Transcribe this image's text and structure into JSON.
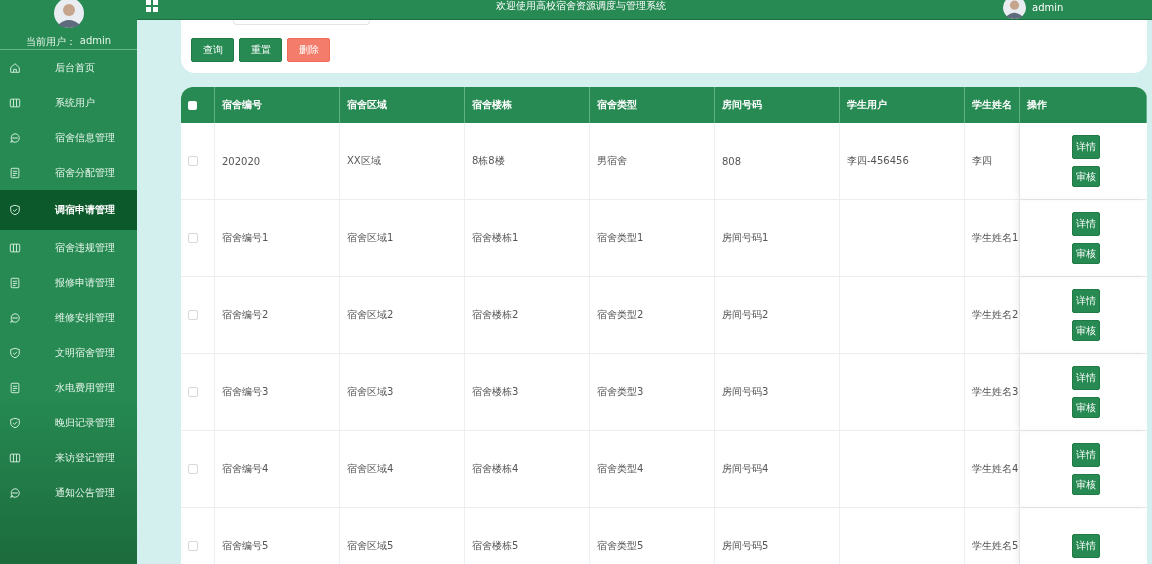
{
  "sidebar": {
    "current_user_label": "当前用户：",
    "current_user": "admin",
    "items": [
      {
        "label": "后台首页",
        "selected": false
      },
      {
        "label": "系统用户",
        "selected": false
      },
      {
        "label": "宿舍信息管理",
        "selected": false
      },
      {
        "label": "宿舍分配管理",
        "selected": false
      },
      {
        "label": "调宿申请管理",
        "selected": true
      },
      {
        "label": "宿舍违规管理",
        "selected": false
      },
      {
        "label": "报修申请管理",
        "selected": false
      },
      {
        "label": "维修安排管理",
        "selected": false
      },
      {
        "label": "文明宿舍管理",
        "selected": false
      },
      {
        "label": "水电费用管理",
        "selected": false
      },
      {
        "label": "晚归记录管理",
        "selected": false
      },
      {
        "label": "来访登记管理",
        "selected": false
      },
      {
        "label": "通知公告管理",
        "selected": false
      }
    ]
  },
  "header": {
    "title": "欢迎使用高校宿舍资源调度与管理系统",
    "user": "admin"
  },
  "toolbar": {
    "buttons": [
      {
        "label": "查询",
        "kind": "primary"
      },
      {
        "label": "重置",
        "kind": "primary"
      },
      {
        "label": "删除",
        "kind": "danger"
      }
    ]
  },
  "table": {
    "header_checked": false,
    "columns": [
      "宿舍编号",
      "宿舍区域",
      "宿舍楼栋",
      "宿舍类型",
      "房间号码",
      "学生用户",
      "学生姓名",
      "操作"
    ],
    "rows": [
      {
        "checked": false,
        "cells": [
          "202020",
          "XX区域",
          "8栋8楼",
          "男宿舍",
          "808",
          "李四-456456",
          "李四"
        ],
        "actions": [
          "详情",
          "审核"
        ]
      },
      {
        "checked": false,
        "cells": [
          "宿舍编号1",
          "宿舍区域1",
          "宿舍楼栋1",
          "宿舍类型1",
          "房间号码1",
          "",
          "学生姓名1"
        ],
        "actions": [
          "详情",
          "审核"
        ]
      },
      {
        "checked": false,
        "cells": [
          "宿舍编号2",
          "宿舍区域2",
          "宿舍楼栋2",
          "宿舍类型2",
          "房间号码2",
          "",
          "学生姓名2"
        ],
        "actions": [
          "详情",
          "审核"
        ]
      },
      {
        "checked": false,
        "cells": [
          "宿舍编号3",
          "宿舍区域3",
          "宿舍楼栋3",
          "宿舍类型3",
          "房间号码3",
          "",
          "学生姓名3"
        ],
        "actions": [
          "详情",
          "审核"
        ]
      },
      {
        "checked": false,
        "cells": [
          "宿舍编号4",
          "宿舍区域4",
          "宿舍楼栋4",
          "宿舍类型4",
          "房间号码4",
          "",
          "学生姓名4"
        ],
        "actions": [
          "详情",
          "审核"
        ]
      },
      {
        "checked": false,
        "cells": [
          "宿舍编号5",
          "宿舍区域5",
          "宿舍楼栋5",
          "宿舍类型5",
          "房间号码5",
          "",
          "学生姓名5"
        ],
        "actions": [
          "详情"
        ]
      }
    ]
  }
}
